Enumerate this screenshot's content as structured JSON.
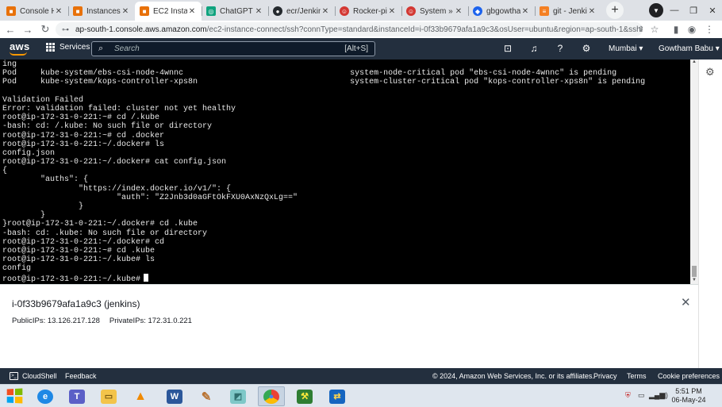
{
  "browser": {
    "tabs": [
      {
        "label": "Console Ho",
        "favicon": "aws-console-icon",
        "color": "#e8710a",
        "active": false
      },
      {
        "label": "Instances |",
        "favicon": "aws-console-icon",
        "color": "#e8710a",
        "active": false
      },
      {
        "label": "EC2 Instanc",
        "favicon": "aws-ec2-icon",
        "color": "#e8710a",
        "active": true
      },
      {
        "label": "ChatGPT",
        "favicon": "chatgpt-icon",
        "color": "#10a37f",
        "active": false
      },
      {
        "label": "ecr/Jenkins",
        "favicon": "github-icon",
        "color": "#24292e",
        "active": false
      },
      {
        "label": "Rocker-pipe",
        "favicon": "jenkins-icon",
        "color": "#d33833",
        "active": false
      },
      {
        "label": "System » Gl",
        "favicon": "jenkins-icon",
        "color": "#d33833",
        "active": false
      },
      {
        "label": "gbgowtham",
        "favicon": "docker-icon",
        "color": "#1d63ed",
        "active": false
      },
      {
        "label": "git - Jenkin",
        "favicon": "stackoverflow-icon",
        "color": "#f48024",
        "active": false
      }
    ],
    "url_host": "ap-south-1.console.aws.amazon.com",
    "url_path": "/ec2-instance-connect/ssh?connType=standard&instanceId=i-0f33b9679afa1a9c3&osUser=ubuntu&region=ap-south-1&sshPort=..."
  },
  "aws_nav": {
    "logo": "aws",
    "services_label": "Services",
    "search_placeholder": "Search",
    "search_shortcut": "[Alt+S]",
    "region": "Mumbai ▾",
    "user": "Gowtham Babu ▾"
  },
  "terminal": {
    "lines": [
      "ing",
      "Pod     kube-system/ebs-csi-node-4wnnc                                   system-node-critical pod \"ebs-csi-node-4wnnc\" is pending",
      "Pod     kube-system/kops-controller-xps8n                                system-cluster-critical pod \"kops-controller-xps8n\" is pending",
      "",
      "Validation Failed",
      "Error: validation failed: cluster not yet healthy",
      "root@ip-172-31-0-221:~# cd /.kube",
      "-bash: cd: /.kube: No such file or directory",
      "root@ip-172-31-0-221:~# cd .docker",
      "root@ip-172-31-0-221:~/.docker# ls",
      "config.json",
      "root@ip-172-31-0-221:~/.docker# cat config.json",
      "{",
      "        \"auths\": {",
      "                \"https://index.docker.io/v1/\": {",
      "                        \"auth\": \"Z2Jnb3d0aGFtOkFXU0AxNzQxLg==\"",
      "                }",
      "        }",
      "}root@ip-172-31-0-221:~/.docker# cd .kube",
      "-bash: cd: .kube: No such file or directory",
      "root@ip-172-31-0-221:~/.docker# cd",
      "root@ip-172-31-0-221:~# cd .kube",
      "root@ip-172-31-0-221:~/.kube# ls",
      "config",
      "root@ip-172-31-0-221:~/.kube#"
    ]
  },
  "instance": {
    "title": "i-0f33b9679afa1a9c3 (jenkins)",
    "public_ips": "PublicIPs: 13.126.217.128",
    "private_ips": "PrivateIPs: 172.31.0.221"
  },
  "aws_footer": {
    "cloudshell": "CloudShell",
    "feedback": "Feedback",
    "copyright": "© 2024, Amazon Web Services, Inc. or its affiliates.",
    "privacy": "Privacy",
    "terms": "Terms",
    "cookie": "Cookie preferences"
  },
  "taskbar": {
    "time": "5:51 PM",
    "date": "06-May-24"
  },
  "colors": {
    "aws_nav_bg": "#232f3e",
    "aws_orange": "#ff9900",
    "terminal_bg": "#000000",
    "chrome_tabstrip": "#dee1e6"
  }
}
